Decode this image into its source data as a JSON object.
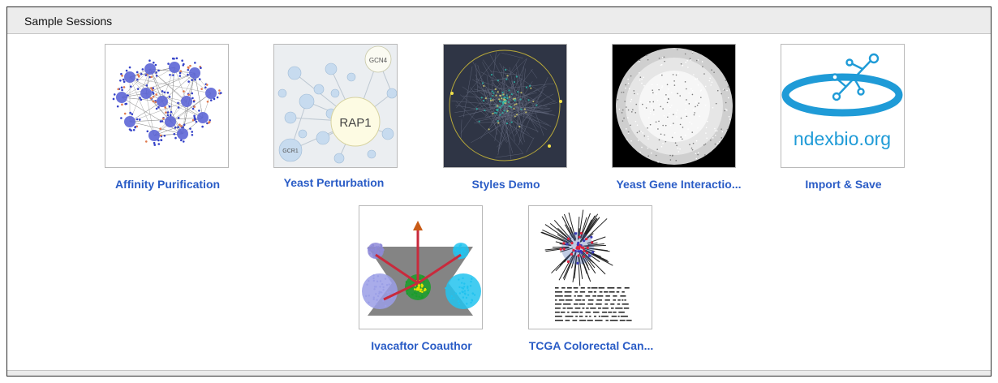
{
  "header": {
    "title": "Sample Sessions"
  },
  "sessions": [
    {
      "label": "Affinity Purification"
    },
    {
      "label": "Yeast Perturbation"
    },
    {
      "label": "Styles Demo"
    },
    {
      "label": "Yeast Gene Interactio..."
    },
    {
      "label": "Import & Save"
    },
    {
      "label": "Ivacaftor Coauthor"
    },
    {
      "label": "TCGA Colorectal Can..."
    }
  ],
  "thumbnails": {
    "yeast_perturbation": {
      "hub": "RAP1",
      "nodes": [
        "GCN4",
        "GCR1"
      ]
    },
    "import_save": {
      "logo_text": "ndexbio.org"
    }
  },
  "colors": {
    "link": "#2a5cc6",
    "header_bg": "#ececec",
    "border": "#2b2b2b"
  }
}
